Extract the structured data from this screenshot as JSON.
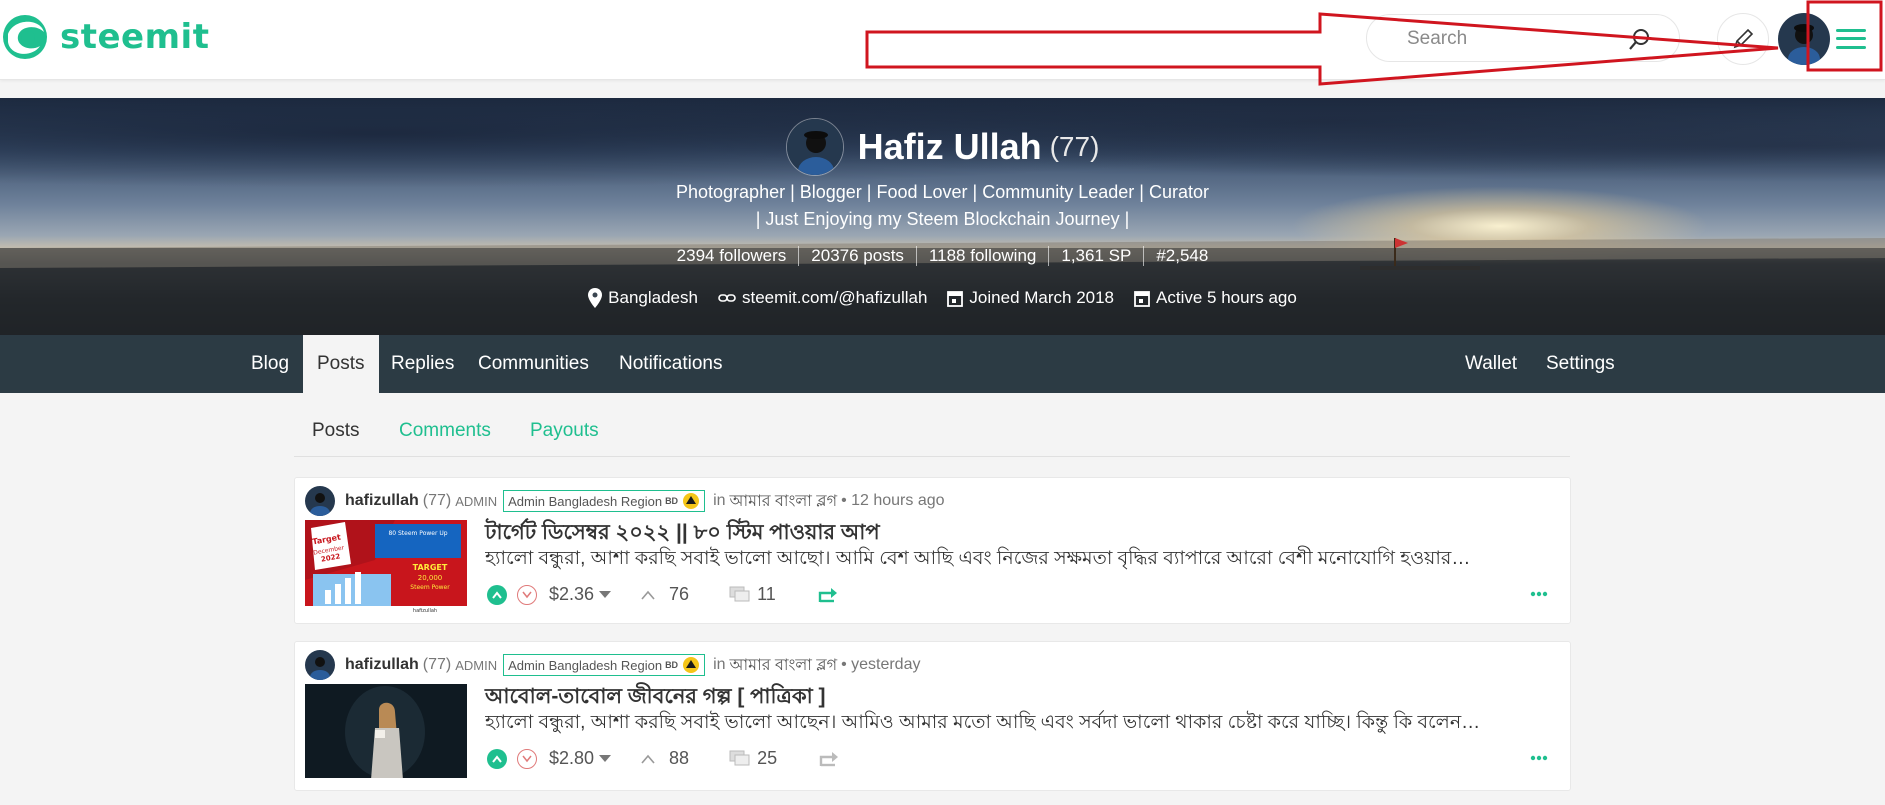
{
  "header": {
    "logo_text": "steemit",
    "search_placeholder": "Search",
    "icons": [
      "steemit-logo-icon",
      "search-icon",
      "pencil-icon",
      "avatar",
      "hamburger-menu-icon"
    ]
  },
  "profile": {
    "name": "Hafiz Ullah",
    "reputation": "(77)",
    "about_line1": "Photographer | Blogger | Food Lover | Community Leader | Curator",
    "about_line2": "| Just Enjoying my Steem Blockchain Journey |",
    "stats": {
      "followers": "2394 followers",
      "posts": "20376 posts",
      "following": "1188 following",
      "sp": "1,361 SP",
      "rank": "#2,548"
    },
    "location": "Bangladesh",
    "website": "steemit.com/@hafizullah",
    "joined": "Joined March 2018",
    "active": "Active 5 hours ago"
  },
  "tabs": {
    "blog": "Blog",
    "posts": "Posts",
    "replies": "Replies",
    "communities": "Communities",
    "notifications": "Notifications",
    "wallet": "Wallet",
    "settings": "Settings"
  },
  "subtabs": {
    "posts": "Posts",
    "comments": "Comments",
    "payouts": "Payouts"
  },
  "posts": [
    {
      "author": "hafizullah",
      "rep": "(77)",
      "role": "ADMIN",
      "badge": "Admin Bangladesh Region",
      "badge_flag": "BD",
      "in_word": "in",
      "community": "আমার বাংলা ব্লগ",
      "time": "• 12 hours ago",
      "title": "টার্গেট ডিসেম্বর ২০২২ || ৮০ স্টিম পাওয়ার আপ",
      "body": "হ্যালো বন্ধুরা, আশা করছি সবাই ভালো আছো। আমি বেশ আছি এবং নিজের সক্ষমতা বৃদ্ধির ব্যাপারে আরো বেশী মনোযোগি হওয়ার…",
      "payout": "$2.36",
      "votes": "76",
      "comments": "11",
      "thumb_text": {
        "target": "Target",
        "month": "December",
        "year": "2022",
        "up": "80 Steem Power Up",
        "target2": "TARGET",
        "amount": "20,000",
        "unit": "Steem Power",
        "footer": "hafizullah"
      }
    },
    {
      "author": "hafizullah",
      "rep": "(77)",
      "role": "ADMIN",
      "badge": "Admin Bangladesh Region",
      "badge_flag": "BD",
      "in_word": "in",
      "community": "আমার বাংলা ব্লগ",
      "time": "• yesterday",
      "title": "আবোল-তাবোল জীবনের গল্প [ পাত্রিকা ]",
      "body": "হ্যালো বন্ধুরা, আশা করছি সবাই ভালো আছেন। আমিও আমার মতো আছি এবং সর্বদা ভালো থাকার চেষ্টা করে যাচ্ছি। কিন্তু কি বলেন…",
      "payout": "$2.80",
      "votes": "88",
      "comments": "25"
    }
  ],
  "colors": {
    "accent": "#1fbf8f",
    "tabbar": "#2c3b44",
    "annotation_red": "#d0151f"
  }
}
